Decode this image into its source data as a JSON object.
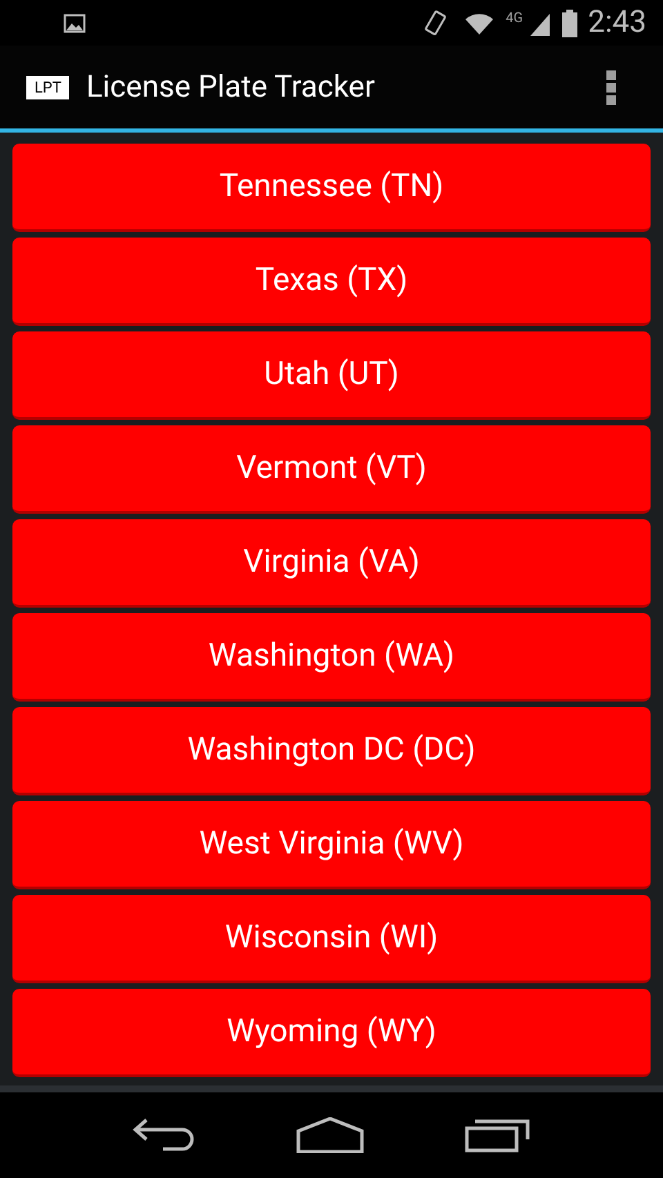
{
  "status_bar": {
    "network": "4G",
    "time": "2:43"
  },
  "action_bar": {
    "logo": "LPT",
    "title": "License Plate Tracker"
  },
  "states": [
    {
      "label": "Tennessee (TN)"
    },
    {
      "label": "Texas (TX)"
    },
    {
      "label": "Utah (UT)"
    },
    {
      "label": "Vermont (VT)"
    },
    {
      "label": "Virginia (VA)"
    },
    {
      "label": "Washington (WA)"
    },
    {
      "label": "Washington DC (DC)"
    },
    {
      "label": "West Virginia (WV)"
    },
    {
      "label": "Wisconsin (WI)"
    },
    {
      "label": "Wyoming (WY)"
    }
  ]
}
